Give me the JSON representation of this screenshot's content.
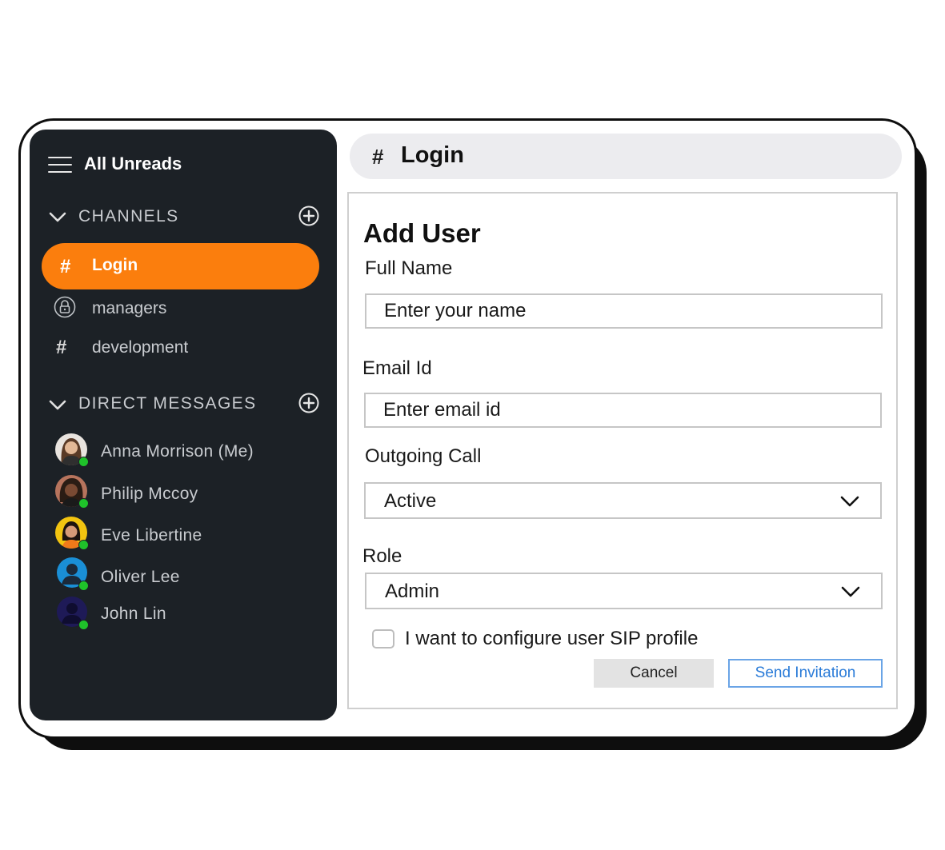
{
  "sidebar": {
    "title": "All Unreads",
    "channels_heading": "CHANNELS",
    "channels": [
      {
        "label": "Login",
        "icon": "hash-icon",
        "active": true
      },
      {
        "label": "managers",
        "icon": "lock-icon",
        "active": false
      },
      {
        "label": "development",
        "icon": "hash-icon",
        "active": false
      }
    ],
    "dm_heading": "DIRECT MESSAGES",
    "direct_messages": [
      {
        "name": "Anna Morrison (Me)",
        "status": "online"
      },
      {
        "name": "Philip Mccoy",
        "status": "online"
      },
      {
        "name": "Eve Libertine",
        "status": "online"
      },
      {
        "name": "Oliver Lee",
        "status": "online"
      },
      {
        "name": "John Lin",
        "status": "online"
      }
    ]
  },
  "header": {
    "hash": "#",
    "title": "Login"
  },
  "form": {
    "title": "Add User",
    "full_name_label": "Full Name",
    "full_name_placeholder": "Enter your name",
    "email_label": "Email Id",
    "email_placeholder": "Enter email id",
    "outgoing_call_label": "Outgoing Call",
    "outgoing_call_value": "Active",
    "role_label": "Role",
    "role_value": "Admin",
    "sip_checkbox_label": "I want to configure user SIP profile",
    "sip_checked": false,
    "cancel_label": "Cancel",
    "send_label": "Send Invitation"
  },
  "colors": {
    "sidebar_bg": "#1c2126",
    "accent": "#fb7e0d",
    "online": "#1fc22a",
    "send_button": "#2a7bd8"
  }
}
